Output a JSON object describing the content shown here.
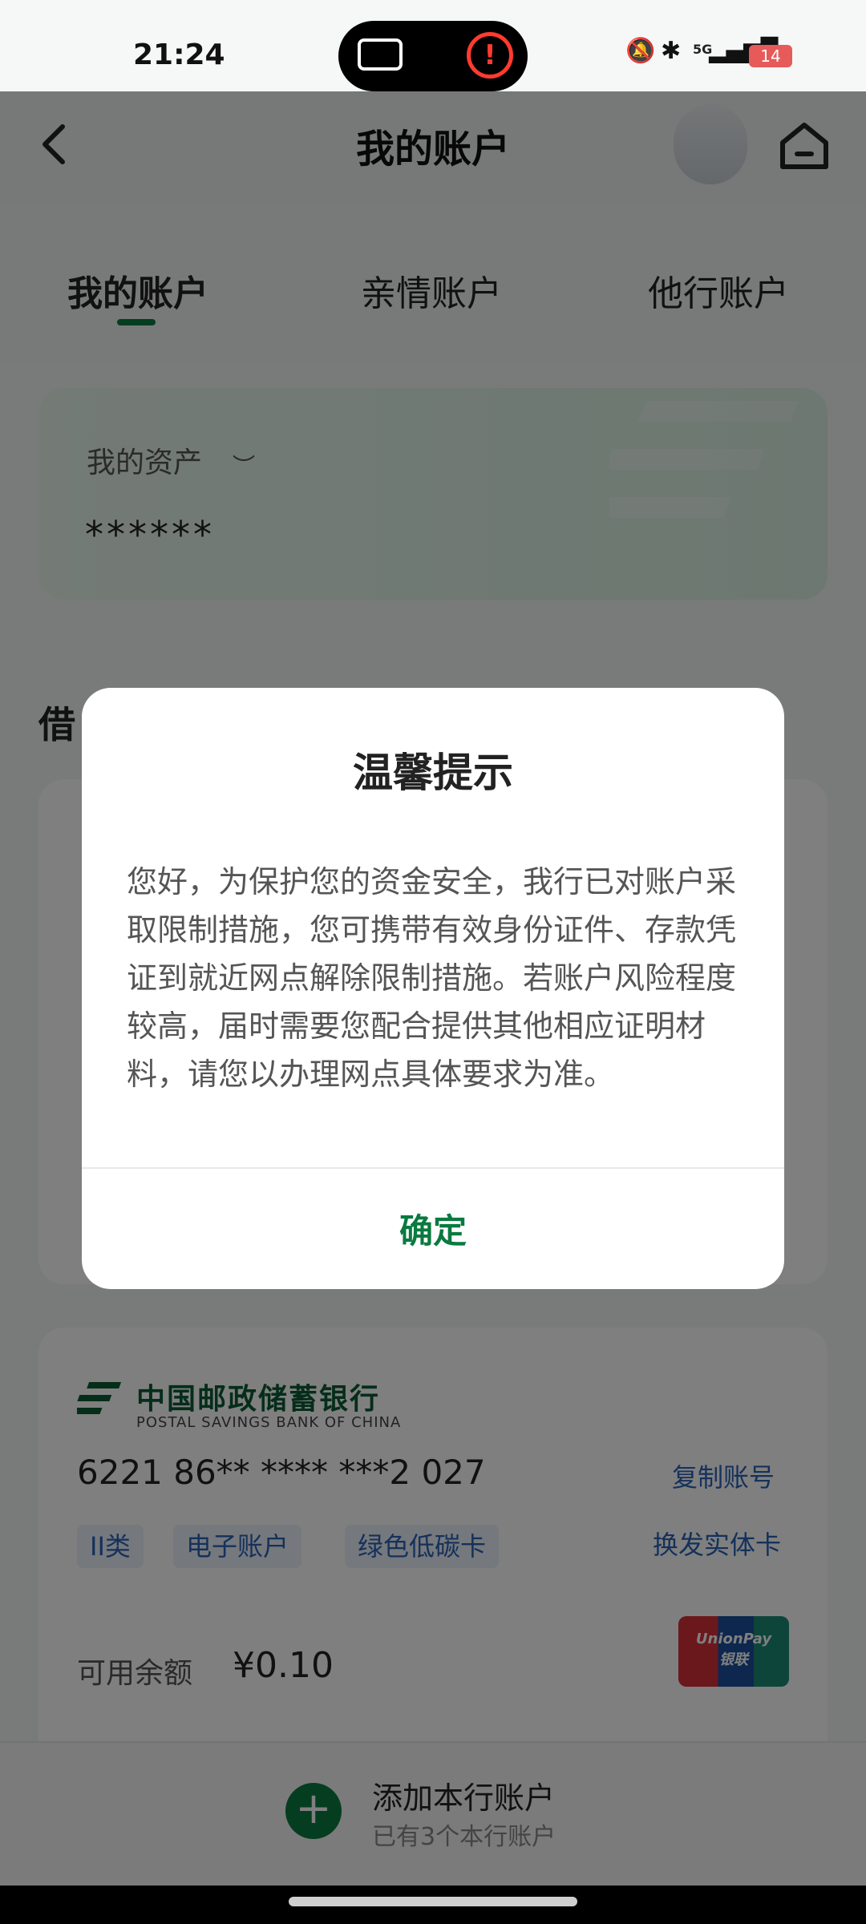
{
  "status_bar": {
    "time": "21:24",
    "battery": "14",
    "signal": "5G"
  },
  "header": {
    "title": "我的账户"
  },
  "tabs": [
    {
      "label": "我的账户",
      "active": true
    },
    {
      "label": "亲情账户",
      "active": false
    },
    {
      "label": "他行账户",
      "active": false
    }
  ],
  "assets": {
    "label": "我的资产",
    "value": "******"
  },
  "section": {
    "title_partial": "借"
  },
  "card": {
    "bank_name_cn": "中国邮政储蓄银行",
    "bank_name_en": "POSTAL SAVINGS BANK OF CHINA",
    "account_number": "6221 86** **** ***2 027",
    "copy_label": "复制账号",
    "tags": [
      "II类",
      "电子账户",
      "绿色低碳卡"
    ],
    "reissue_label": "换发实体卡",
    "balance_label": "可用余额",
    "balance_value": "¥0.10",
    "unionpay_label": "UnionPay",
    "unionpay_cn": "银联"
  },
  "bottom": {
    "add_title": "添加本行账户",
    "add_sub": "已有3个本行账户"
  },
  "modal": {
    "title": "温馨提示",
    "body": "您好，为保护您的资金安全，我行已对账户采取限制措施，您可携带有效身份证件、存款凭证到就近网点解除限制措施。若账户风险程度较高，届时需要您配合提供其他相应证明材料，请您以办理网点具体要求为准。",
    "confirm": "确定"
  },
  "colors": {
    "brand_green": "#0a7a40",
    "link_blue": "#2b63b6",
    "alert_red": "#ff3b30"
  }
}
